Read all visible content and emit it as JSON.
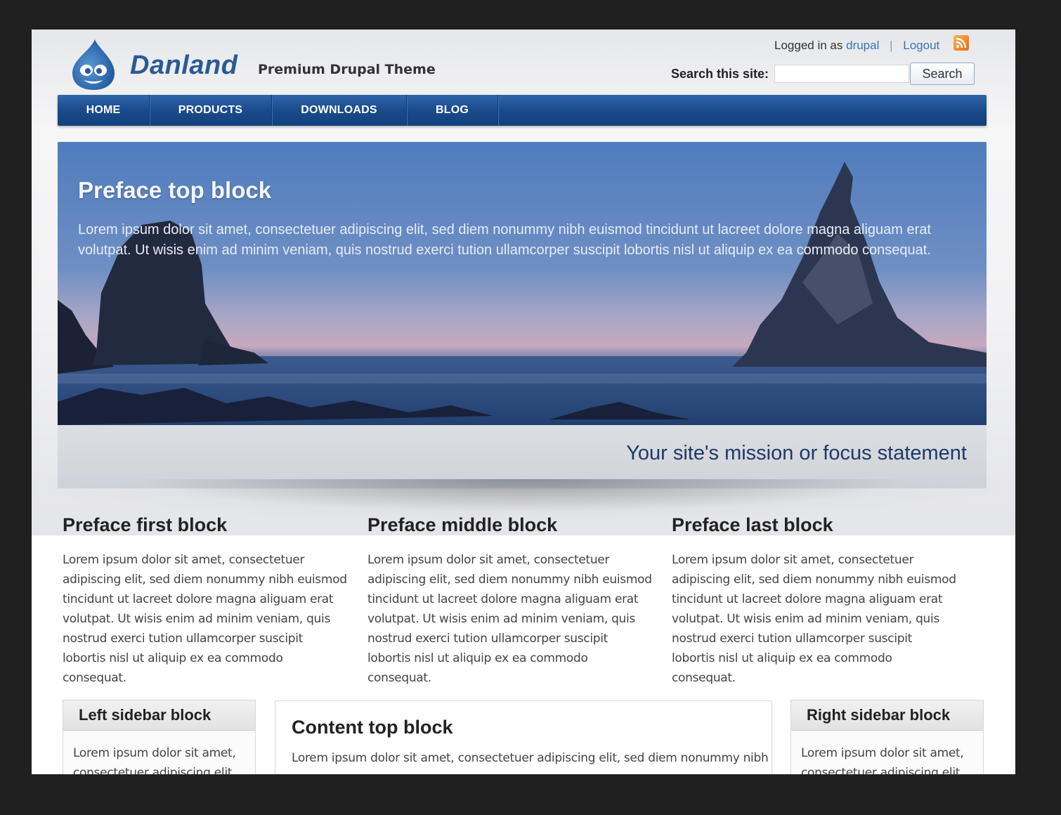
{
  "header": {
    "site_name": "Danland",
    "slogan": "Premium Drupal Theme",
    "logged_in_prefix": "Logged in as",
    "username": "drupal",
    "separator": "|",
    "logout": "Logout",
    "search_label": "Search this site:",
    "search_value": "",
    "search_button": "Search",
    "rss_icon": "rss-icon"
  },
  "nav": {
    "items": [
      {
        "label": "HOME"
      },
      {
        "label": "PRODUCTS"
      },
      {
        "label": "DOWNLOADS"
      },
      {
        "label": "BLOG"
      }
    ]
  },
  "banner": {
    "title": "Preface top block",
    "text": "Lorem ipsum dolor sit amet, consectetuer adipiscing elit, sed diem nonummy nibh euismod tincidunt ut lacreet dolore magna aliguam erat volutpat. Ut wisis enim ad minim veniam, quis nostrud exerci tution ullamcorper suscipit lobortis nisl ut aliquip ex ea commodo consequat.",
    "mission": "Your site's mission or focus statement"
  },
  "preface": [
    {
      "title": "Preface first block",
      "text": "Lorem ipsum dolor sit amet, consectetuer adipiscing elit, sed diem nonummy nibh euismod tincidunt ut lacreet dolore magna aliguam erat volutpat. Ut wisis enim ad minim veniam, quis nostrud exerci tution ullamcorper suscipit lobortis nisl ut aliquip ex ea commodo consequat."
    },
    {
      "title": "Preface middle block",
      "text": "Lorem ipsum dolor sit amet, consectetuer adipiscing elit, sed diem nonummy nibh euismod tincidunt ut lacreet dolore magna aliguam erat volutpat. Ut wisis enim ad minim veniam, quis nostrud exerci tution ullamcorper suscipit lobortis nisl ut aliquip ex ea commodo consequat."
    },
    {
      "title": "Preface last block",
      "text": "Lorem ipsum dolor sit amet, consectetuer adipiscing elit, sed diem nonummy nibh euismod tincidunt ut lacreet dolore magna aliguam erat volutpat. Ut wisis enim ad minim veniam, quis nostrud exerci tution ullamcorper suscipit lobortis nisl ut aliquip ex ea commodo consequat."
    }
  ],
  "left_sidebar": {
    "title": "Left sidebar block",
    "text": "Lorem ipsum dolor sit amet, consectetuer adipiscing elit,"
  },
  "content_top": {
    "title": "Content top block",
    "text": "Lorem ipsum dolor sit amet, consectetuer adipiscing elit, sed diem nonummy nibh"
  },
  "right_sidebar": {
    "title": "Right sidebar block",
    "text": "Lorem ipsum dolor sit amet, consectetuer adipiscing elit,"
  },
  "colors": {
    "nav_blue": "#1a4b8c",
    "brand_blue": "#2a5a93",
    "link_blue": "#3a73b7",
    "mission_text": "#1d3a66"
  }
}
